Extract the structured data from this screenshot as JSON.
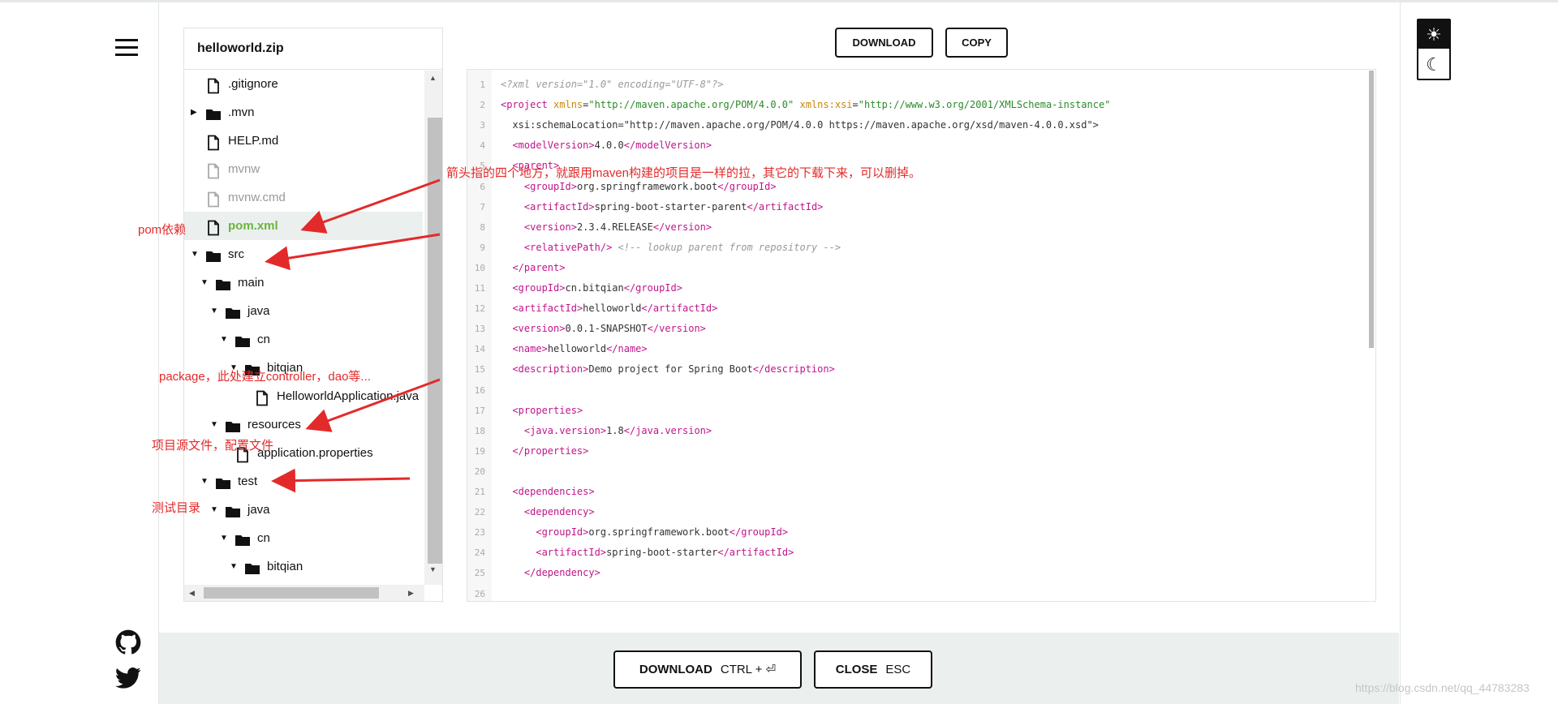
{
  "header": {
    "download_label": "DOWNLOAD",
    "copy_label": "COPY"
  },
  "tree": {
    "title": "helloworld.zip",
    "items": [
      {
        "label": ".gitignore"
      },
      {
        "label": ".mvn"
      },
      {
        "label": "HELP.md"
      },
      {
        "label": "mvnw"
      },
      {
        "label": "mvnw.cmd"
      },
      {
        "label": "pom.xml"
      },
      {
        "label": "src"
      },
      {
        "label": "main"
      },
      {
        "label": "java"
      },
      {
        "label": "cn"
      },
      {
        "label": "bitqian"
      },
      {
        "label": "HelloworldApplication.java"
      },
      {
        "label": "resources"
      },
      {
        "label": "application.properties"
      },
      {
        "label": "test"
      },
      {
        "label": "java"
      },
      {
        "label": "cn"
      },
      {
        "label": "bitqian"
      }
    ]
  },
  "code": {
    "line_numbers": [
      "1",
      "2",
      "3",
      "4",
      "5",
      "6",
      "7",
      "8",
      "9",
      "10",
      "11",
      "12",
      "13",
      "14",
      "15",
      "16",
      "17",
      "18",
      "19",
      "20",
      "21",
      "22",
      "23",
      "24",
      "25",
      "26"
    ],
    "lines": [
      "<?xml version=\"1.0\" encoding=\"UTF-8\"?>",
      "<project xmlns=\"http://maven.apache.org/POM/4.0.0\" xmlns:xsi=\"http://www.w3.org/2001/XMLSchema-instance\"",
      "  xsi:schemaLocation=\"http://maven.apache.org/POM/4.0.0 https://maven.apache.org/xsd/maven-4.0.0.xsd\">",
      "  <modelVersion>4.0.0</modelVersion>",
      "  <parent>",
      "    <groupId>org.springframework.boot</groupId>",
      "    <artifactId>spring-boot-starter-parent</artifactId>",
      "    <version>2.3.4.RELEASE</version>",
      "    <relativePath/> <!-- lookup parent from repository -->",
      "  </parent>",
      "  <groupId>cn.bitqian</groupId>",
      "  <artifactId>helloworld</artifactId>",
      "  <version>0.0.1-SNAPSHOT</version>",
      "  <name>helloworld</name>",
      "  <description>Demo project for Spring Boot</description>",
      "",
      "  <properties>",
      "    <java.version>1.8</java.version>",
      "  </properties>",
      "",
      "  <dependencies>",
      "    <dependency>",
      "      <groupId>org.springframework.boot</groupId>",
      "      <artifactId>spring-boot-starter</artifactId>",
      "    </dependency>",
      ""
    ]
  },
  "footer": {
    "download_label": "DOWNLOAD",
    "download_shortcut": "CTRL + ⏎",
    "close_label": "CLOSE",
    "close_shortcut": "ESC"
  },
  "annotations": {
    "top_note": "箭头指的四个地方，就跟用maven构建的项目是一样的拉，其它的下载下来，可以删掉。",
    "pom": "pom依赖",
    "package": "package，此处建立controller，dao等...",
    "resources": "项目源文件，配置文件",
    "test": "测试目录"
  },
  "watermark": "https://blog.csdn.net/qq_44783283",
  "colors": {
    "accent_green": "#6db33f",
    "annotation_red": "#e32a2a",
    "xml_tag": "#c0158a",
    "xml_attr": "#c78708",
    "xml_string": "#2a8a2a"
  },
  "icons": {
    "menu": "hamburger-icon",
    "sun": "sun-icon",
    "moon": "moon-icon",
    "github": "github-icon",
    "twitter": "twitter-icon"
  }
}
